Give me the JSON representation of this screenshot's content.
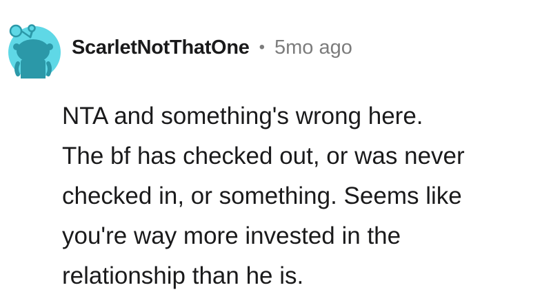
{
  "comment": {
    "author": "ScarletNotThatOne",
    "separator": "•",
    "time_ago": "5mo ago",
    "body": "NTA and something's wrong here.\nThe bf has checked out, or was never\nchecked in, or something. Seems like\nyou're way more invested in the\nrelationship than he is."
  },
  "avatar": {
    "icon": "reddit-snoo-avatar-icon",
    "background_color": "#5fd8e6",
    "figure_color": "#2b98a8"
  }
}
